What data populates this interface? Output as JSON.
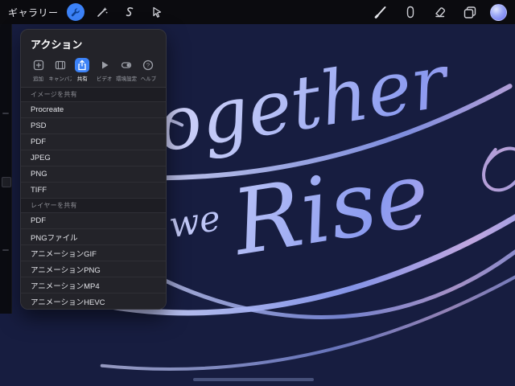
{
  "topbar": {
    "gallery_label": "ギャラリー"
  },
  "actions_menu": {
    "title": "アクション",
    "tabs": [
      {
        "label": "追加",
        "icon": "add-icon",
        "selected": false
      },
      {
        "label": "キャンバス",
        "icon": "canvas-icon",
        "selected": false
      },
      {
        "label": "共有",
        "icon": "share-icon",
        "selected": true
      },
      {
        "label": "ビデオ",
        "icon": "video-icon",
        "selected": false
      },
      {
        "label": "環境設定",
        "icon": "preferences-icon",
        "selected": false
      },
      {
        "label": "ヘルプ",
        "icon": "help-icon",
        "selected": false
      }
    ],
    "sections": [
      {
        "header": "イメージを共有",
        "items": [
          "Procreate",
          "PSD",
          "PDF",
          "JPEG",
          "PNG",
          "TIFF"
        ]
      },
      {
        "header": "レイヤーを共有",
        "items": [
          "PDF",
          "PNGファイル",
          "アニメーションGIF",
          "アニメーションPNG",
          "アニメーションMP4",
          "アニメーションHEVC"
        ]
      }
    ]
  },
  "canvas": {
    "artwork_words": {
      "line1": "Together",
      "line2_small": "we",
      "line2": "Rise"
    }
  },
  "colors": {
    "accent_blue": "#3c82f7",
    "topbar_bg": "#0b0b0f",
    "menu_bg": "#232329",
    "canvas_bg": "#171d40",
    "lettering": "#a9b4f2"
  }
}
